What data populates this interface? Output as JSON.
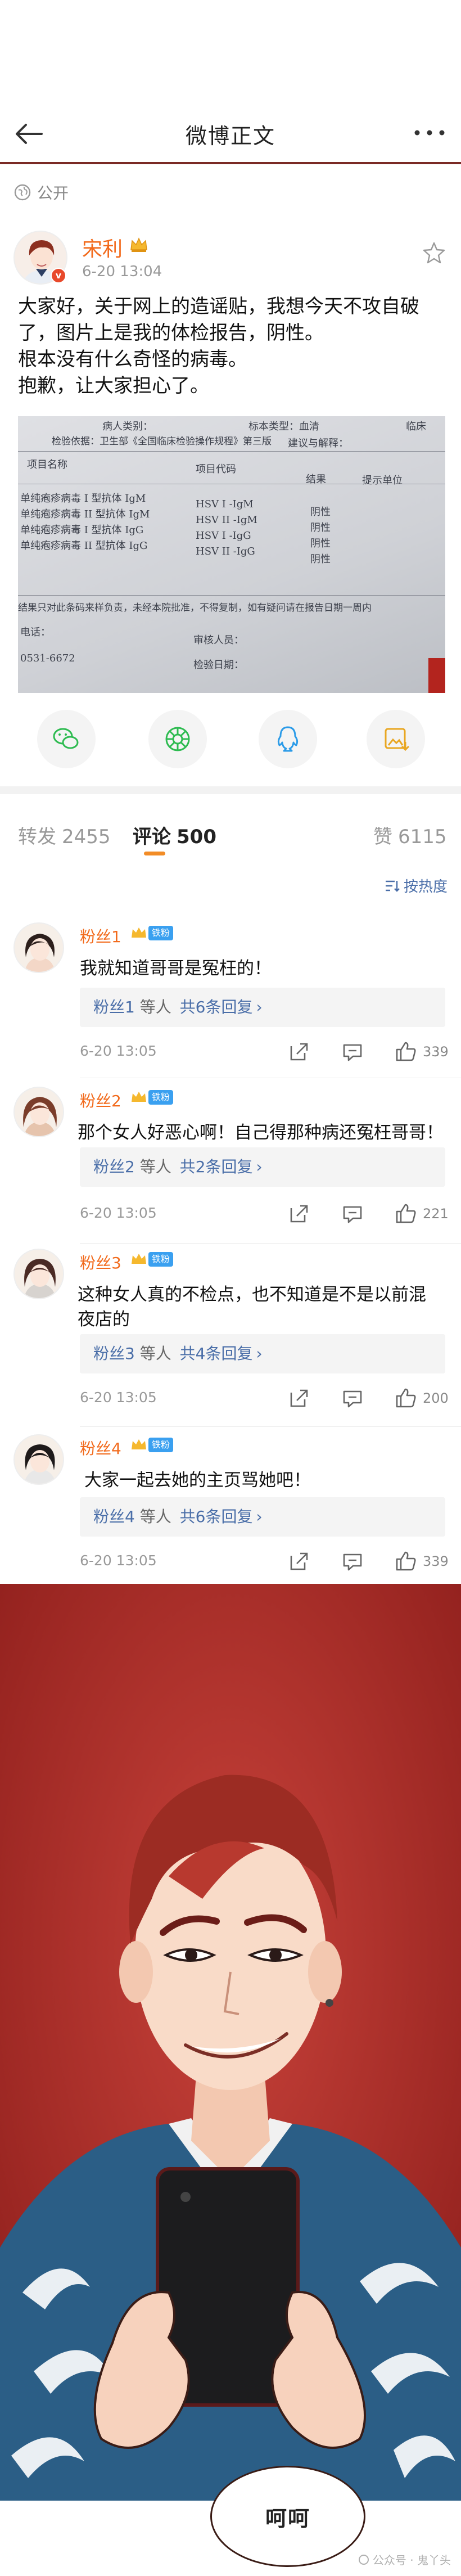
{
  "nav": {
    "title": "微博正文",
    "more": "···"
  },
  "post": {
    "visibility": "公开",
    "author": "宋利",
    "time": "6-20 13:04",
    "text_lines": [
      "大家好，关于网上的造谣贴，我想今天不攻自破",
      "了，图片上是我的体检报告，阴性。",
      "根本没有什么奇怪的病毒。",
      "抱歉，让大家担心了。"
    ]
  },
  "report": {
    "top_left": "检验依据：卫生部《全国临床检验操作规程》第三版",
    "top_mid": "病人类别：",
    "top_right1": "标本类型：血清",
    "top_right2": "临床",
    "top_right3": "建议与解释：",
    "headers": [
      "项目名称",
      "项目代码",
      "结果",
      "提示单位"
    ],
    "rows": [
      [
        "单纯疱疹病毒 I 型抗体 IgM",
        "HSV I -IgM",
        "阴性"
      ],
      [
        "单纯疱疹病毒 II 型抗体 IgM",
        "HSV II -IgM",
        "阴性"
      ],
      [
        "单纯疱疹病毒 I 型抗体 IgG",
        "HSV I -IgG",
        "阴性"
      ],
      [
        "单纯疱疹病毒 II 型抗体 IgG",
        "HSV II -IgG",
        "阴性"
      ]
    ],
    "footer": "结果只对此条码来样负责，未经本院批准，不得复制，如有疑问请在报告日期一周内",
    "footer2": "电话：",
    "phone": "0531-6672",
    "reviewer": "审核人员：",
    "tester": "检验日期："
  },
  "share_icons": [
    "wechat-icon",
    "moments-icon",
    "qq-icon",
    "save-image-icon"
  ],
  "tabs": {
    "repost_label": "转发",
    "repost_count": "2455",
    "comment_label": "评论",
    "comment_count": "500",
    "like_label": "赞",
    "like_count": "6115",
    "sort_label": "按热度"
  },
  "comments": [
    {
      "name": "粉丝1",
      "badge": "铁粉",
      "text": "我就知道哥哥是冤枉的！",
      "reply_who": "粉丝1",
      "reply_mid": " 等人 ",
      "reply_count": "共6条回复",
      "time": "6-20 13:05",
      "likes": "339"
    },
    {
      "name": "粉丝2",
      "badge": "铁粉",
      "text": "那个女人好恶心啊！自己得那种病还冤枉哥哥！",
      "reply_who": "粉丝2",
      "reply_mid": " 等人 ",
      "reply_count": "共2条回复",
      "time": "6-20 13:05",
      "likes": "221"
    },
    {
      "name": "粉丝3",
      "badge": "铁粉",
      "text": "这种女人真的不检点，也不知道是不是以前混夜店的",
      "reply_who": "粉丝3",
      "reply_mid": " 等人 ",
      "reply_count": "共4条回复",
      "time": "6-20 13:05",
      "likes": "200"
    },
    {
      "name": "粉丝4",
      "badge": "铁粉",
      "text": "大家一起去她的主页骂她吧！",
      "reply_who": "粉丝4",
      "reply_mid": " 等人 ",
      "reply_count": "共6条回复",
      "time": "6-20 13:05",
      "likes": "339"
    }
  ],
  "comic": {
    "speech": "呵呵"
  },
  "watermark": "公众号 · 鬼丫头",
  "colors": {
    "accent": "#f26b1d",
    "link": "#4a6ea8",
    "comic_bg": "#b3312d",
    "header_border": "#7a2a25"
  }
}
